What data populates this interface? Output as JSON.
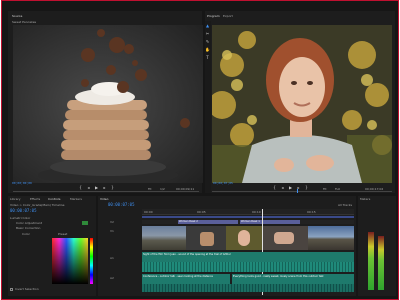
{
  "app": {
    "left_monitor": {
      "tab": "Source",
      "clip": "Sweet Pancakes",
      "timecode_left": "00;00;00;00",
      "timecode_right": "00;00;09;11",
      "fit": "Fit",
      "quality": "1/2"
    },
    "right_monitor": {
      "tab_active": "Program",
      "tab_other": "Export",
      "timecode_left": "00;00;07;05",
      "timecode_right": "00;00;17;02",
      "fit": "Fit",
      "quality": "Full"
    },
    "effect_panel": {
      "tabs": [
        "Library",
        "Effects",
        "Controls",
        "Markers"
      ],
      "active_tab": "Controls",
      "breadcrumb": "Video > Color_Grade(Main) Timeline",
      "timecode": "00:00:07:05",
      "sections": [
        "Lumetri Color",
        "Color Adjustment",
        "Basic Correction"
      ],
      "fields": [
        "Color",
        "Preset"
      ],
      "checkbox_label": "Invert Selection"
    },
    "timeline": {
      "tab": "Video",
      "timecode": "00:00:07:05",
      "markers": [
        "00:00",
        "00:05",
        "00:10",
        "00:15"
      ],
      "tracks": [
        "V2",
        "V1",
        "A1",
        "A2"
      ],
      "video_clips": [
        "Woman Desk 2",
        "Woman Desk 1"
      ],
      "audio_caption_1": "Sight of the film from Juan - sound of the opening at the trail of Arthur",
      "audio_caption_2": "Conference - outdoor talk - seen looking at the distance",
      "audio_caption_3": "Everything looks good - really sweet, lovely scene from this outdoor talk",
      "right_label": "All Tracks"
    },
    "audio_meter": {
      "title": "Meters",
      "levels": [
        0.72,
        0.68
      ]
    },
    "colors": {
      "accent": "#3e8ff0",
      "frame": "#c01030",
      "audio": "#1e8a7a",
      "video": "#4a5a8c"
    }
  }
}
